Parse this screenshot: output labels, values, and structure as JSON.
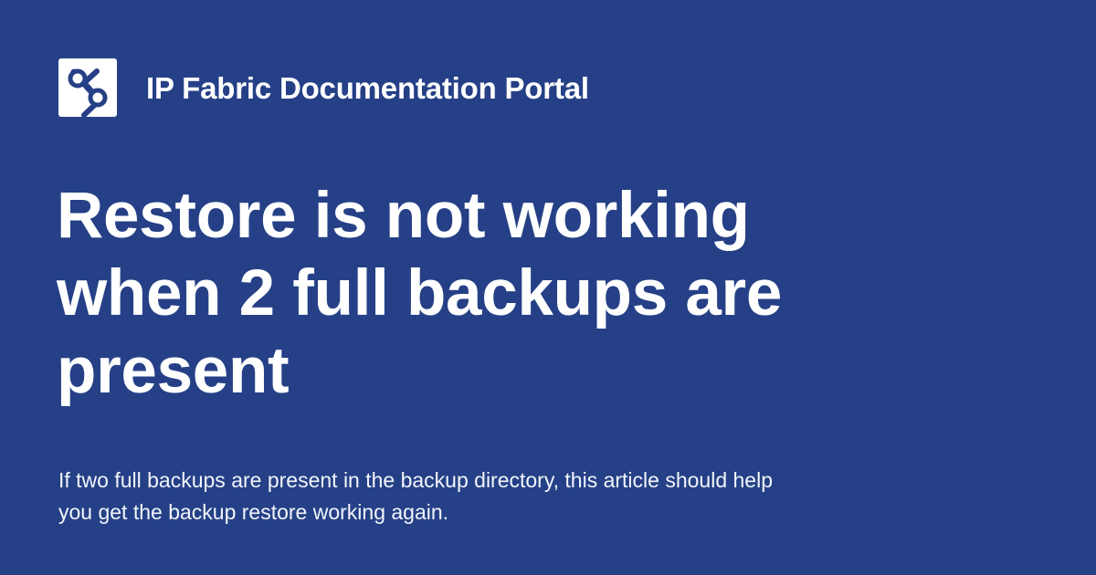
{
  "header": {
    "logo_icon": "ip-fabric-logo-icon",
    "site_name": "IP Fabric Documentation Portal"
  },
  "article": {
    "title": "Restore is not working when 2 full backups are present",
    "description": "If two full backups are present in the backup directory, this article should help you get the backup restore working again."
  },
  "colors": {
    "background": "#254086",
    "text": "#ffffff"
  }
}
